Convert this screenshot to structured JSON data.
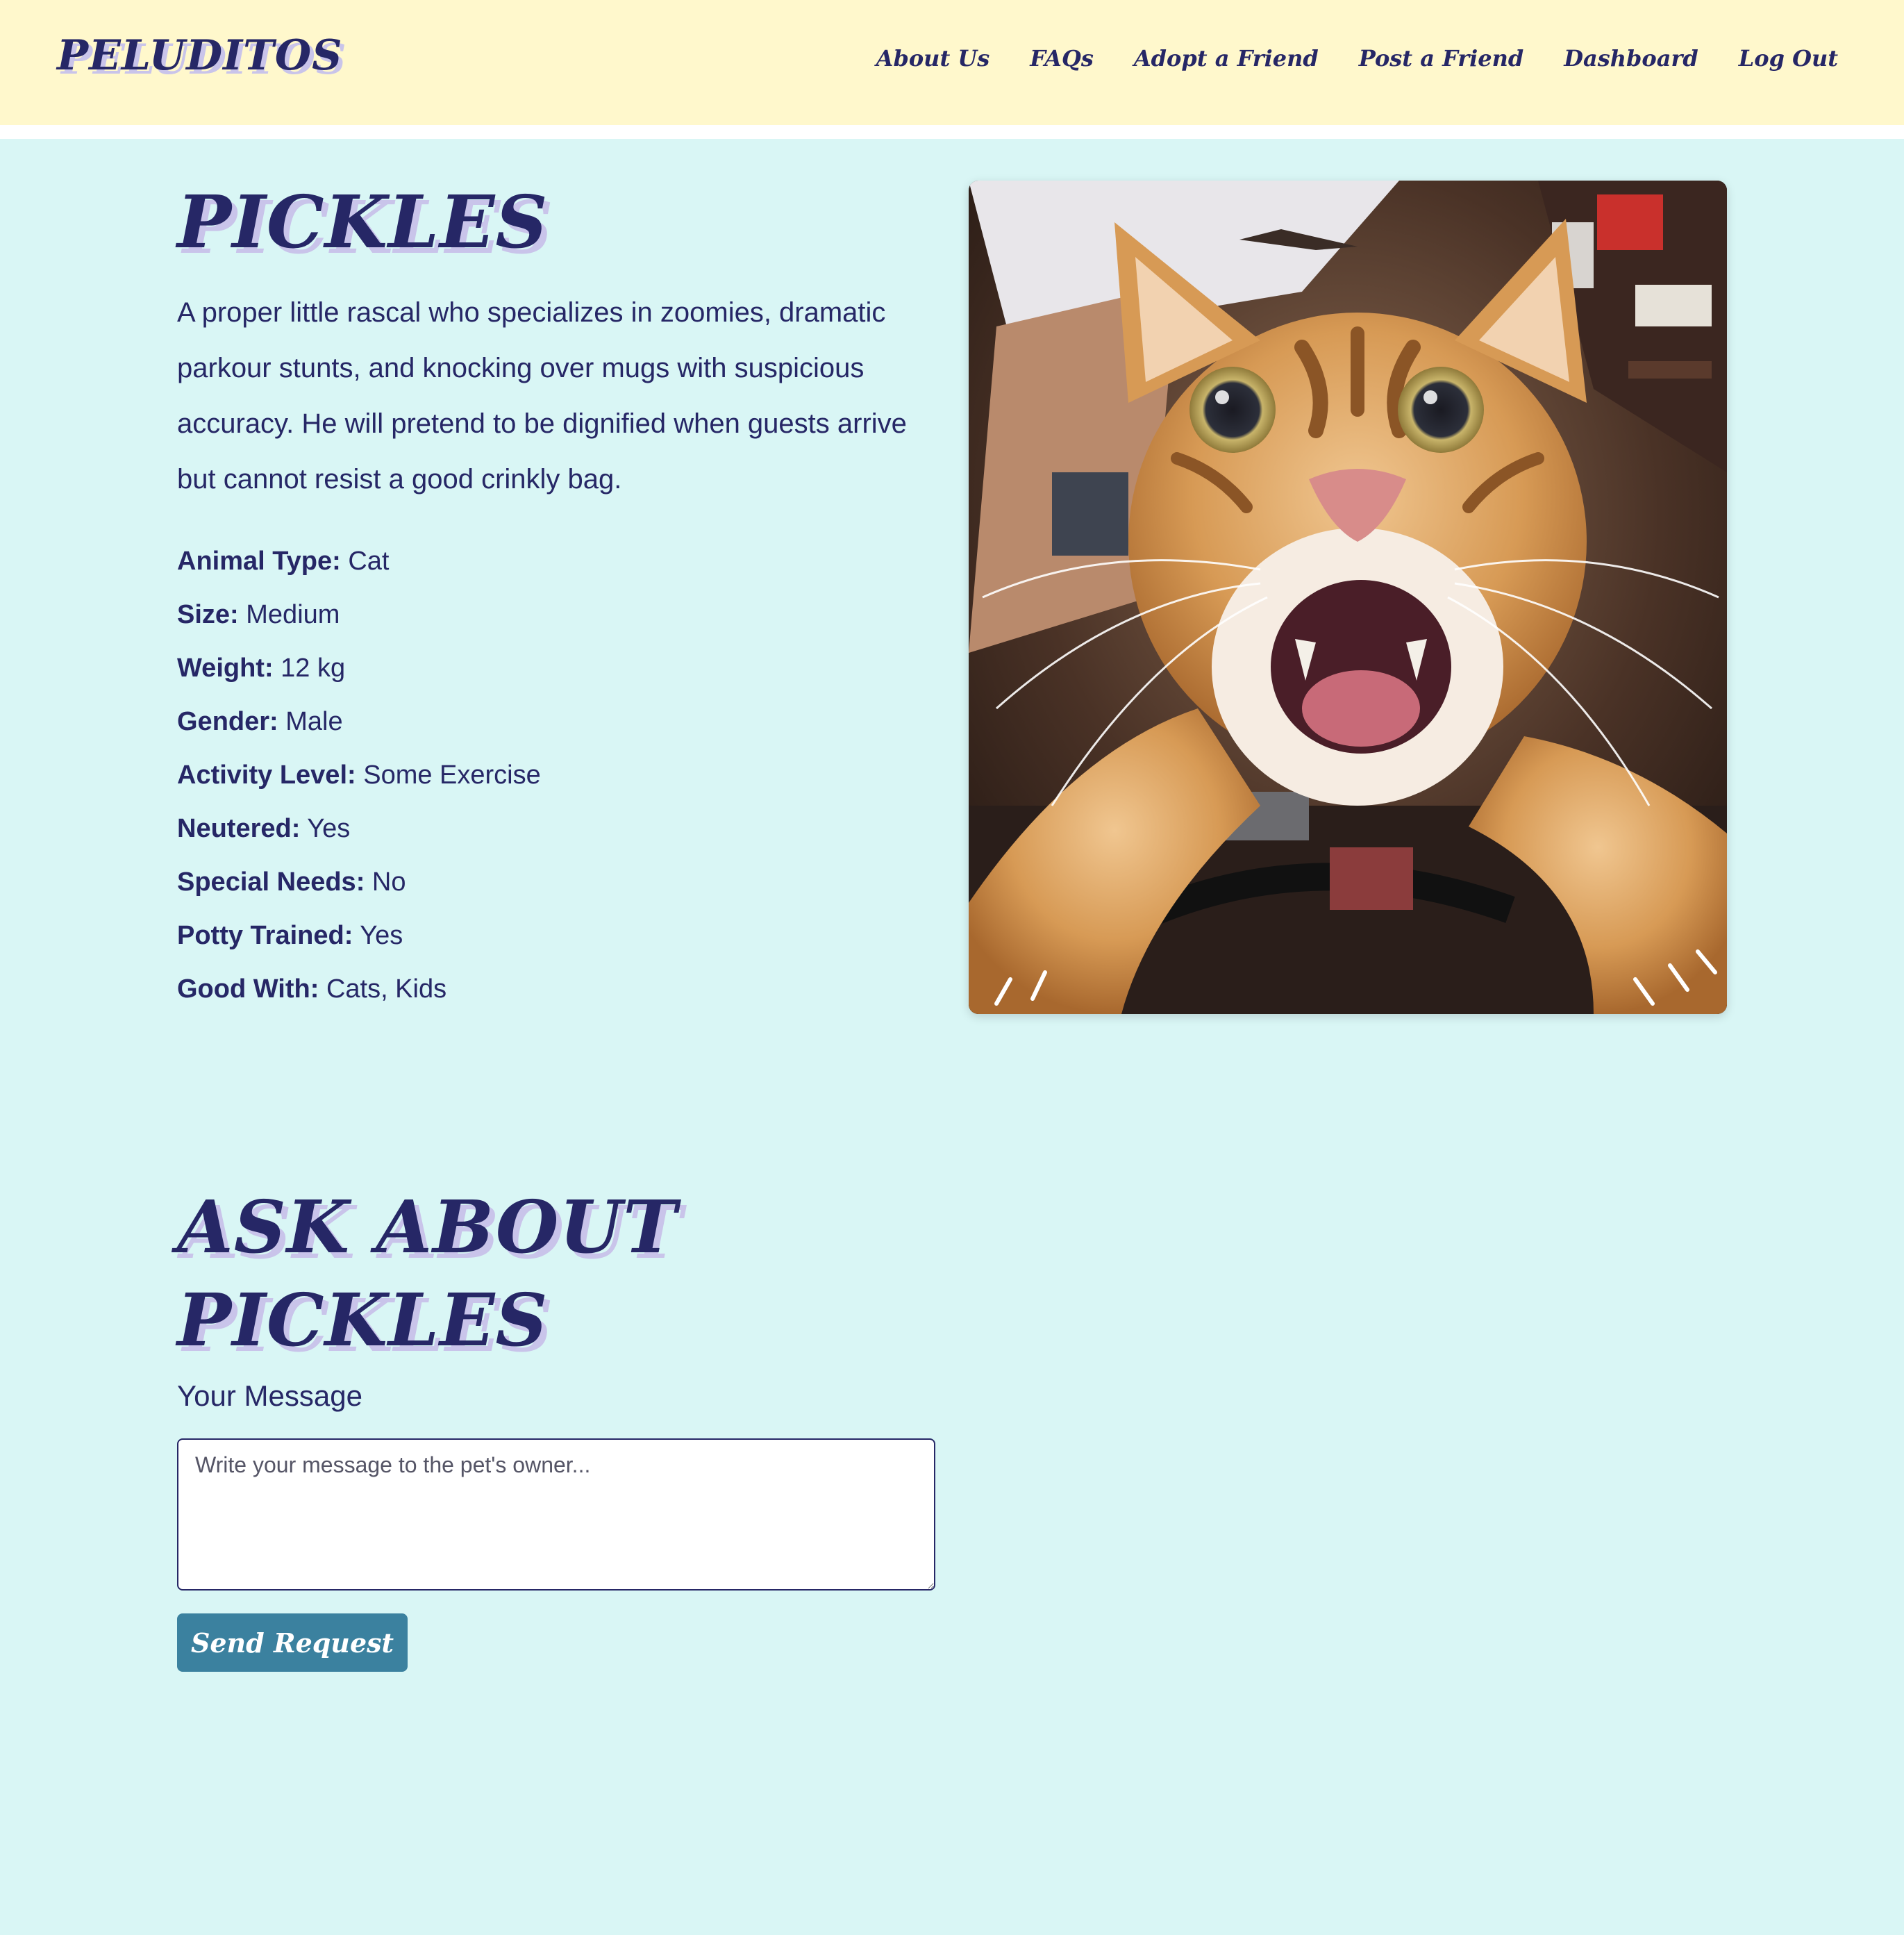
{
  "brand": {
    "name": "PELUDITOS"
  },
  "nav": {
    "about": "About Us",
    "faqs": "FAQs",
    "adopt": "Adopt a Friend",
    "post": "Post a Friend",
    "dashboard": "Dashboard",
    "logout": "Log Out"
  },
  "pet": {
    "name": "PICKLES",
    "description": "A proper little rascal who specializes in zoomies, dramatic parkour stunts, and knocking over mugs with suspicious accuracy. He will pretend to be dignified when guests arrive but cannot resist a good crinkly bag.",
    "facts": [
      {
        "label": "Animal Type:",
        "value": "Cat"
      },
      {
        "label": "Size:",
        "value": "Medium"
      },
      {
        "label": "Weight:",
        "value": "12 kg"
      },
      {
        "label": "Gender:",
        "value": "Male"
      },
      {
        "label": "Activity Level:",
        "value": "Some Exercise"
      },
      {
        "label": "Neutered:",
        "value": "Yes"
      },
      {
        "label": "Special Needs:",
        "value": "No"
      },
      {
        "label": "Potty Trained:",
        "value": "Yes"
      },
      {
        "label": "Good With:",
        "value": "Cats, Kids"
      }
    ]
  },
  "ask": {
    "title_line1": "ASK ABOUT",
    "title_line2": "PICKLES",
    "message_label": "Your Message",
    "message_placeholder": "Write your message to the pet's owner...",
    "message_value": "",
    "send_label": "Send Request"
  },
  "colors": {
    "header_bg": "#fff8cc",
    "page_bg": "#d9f6f5",
    "ink": "#262766",
    "title_shadow": "#c9c4ea",
    "button_bg": "#3b819f"
  }
}
